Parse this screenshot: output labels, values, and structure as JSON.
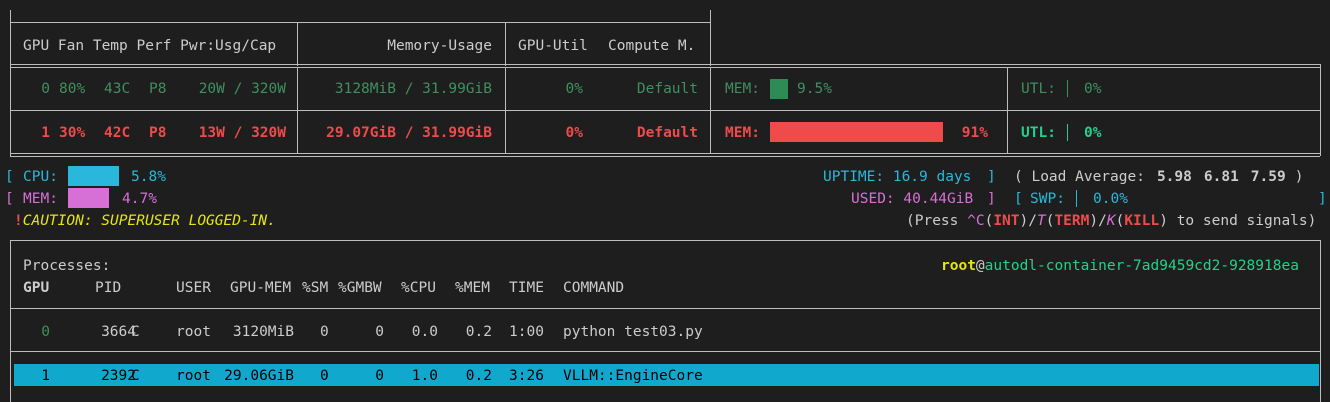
{
  "gpu_header": {
    "col1": "GPU Fan Temp Perf Pwr:Usg/Cap",
    "col2": "Memory-Usage",
    "col3": "GPU-Util",
    "col4": "Compute M."
  },
  "gpus": [
    {
      "id": "0",
      "fan": "80%",
      "temp": "43C",
      "perf": "P8",
      "power": "20W / 320W",
      "memory": "3128MiB / 31.99GiB",
      "util": "0%",
      "compute": "Default",
      "mem_label": "MEM:",
      "mem_pct": "9.5%",
      "mem_frac": 0.095,
      "utl_label": "UTL:",
      "utl_pct": "0%"
    },
    {
      "id": "1",
      "fan": "30%",
      "temp": "42C",
      "perf": "P8",
      "power": "13W / 320W",
      "memory": "29.07GiB / 31.99GiB",
      "util": "0%",
      "compute": "Default",
      "mem_label": "MEM:",
      "mem_pct": "91%",
      "mem_frac": 0.91,
      "utl_label": "UTL:",
      "utl_pct": "0%"
    }
  ],
  "host": {
    "cpu_label": "CPU:",
    "cpu_pct": "5.8%",
    "cpu_frac": 0.058,
    "mem_label": "MEM:",
    "mem_pct": "4.7%",
    "mem_frac": 0.047,
    "uptime": "UPTIME: 16.9 days",
    "load_label": "( Load Average:",
    "load_1": "5.98",
    "load_5": "6.81",
    "load_15": "7.59",
    "load_close": ")",
    "used": "USED: 40.44GiB",
    "swp_label": "SWP:",
    "swp_pct": "0.0%",
    "caution_bang": "!",
    "caution": "CAUTION: SUPERUSER LOGGED-IN.",
    "signals_press": "(Press ",
    "sig_c": "^C",
    "sig_int": "INT",
    "sig_t": "T",
    "sig_term": "TERM",
    "sig_k": "K",
    "sig_kill": "KILL",
    "signals_tail": ") to send signals)"
  },
  "processes": {
    "title": "Processes:",
    "user": "root",
    "at": "@",
    "host": "autodl-container-7ad9459cd2-928918ea",
    "columns": [
      "GPU",
      "PID",
      "USER",
      "GPU-MEM",
      "%SM",
      "%GMBW",
      "%CPU",
      "%MEM",
      "TIME",
      "COMMAND"
    ],
    "rows": [
      {
        "gpu": "0",
        "pid": "3664",
        "type": "C",
        "user": "root",
        "gpu_mem": "3120MiB",
        "sm": "0",
        "gmbw": "0",
        "cpu": "0.0",
        "mem": "0.2",
        "time": "1:00",
        "command": "python test03.py"
      },
      {
        "gpu": "1",
        "pid": "2392",
        "type": "C",
        "user": "root",
        "gpu_mem": "29.06GiB",
        "sm": "0",
        "gmbw": "0",
        "cpu": "1.0",
        "mem": "0.2",
        "time": "3:26",
        "command": "VLLM::EngineCore"
      }
    ]
  },
  "colors": {
    "bg": "#1e1e1e",
    "gpu0": "#3f8f5f",
    "gpu1": "#ef4b4b",
    "cpu": "#29b8db",
    "mem": "#d670d6",
    "selected_row": "#11a8cd"
  }
}
